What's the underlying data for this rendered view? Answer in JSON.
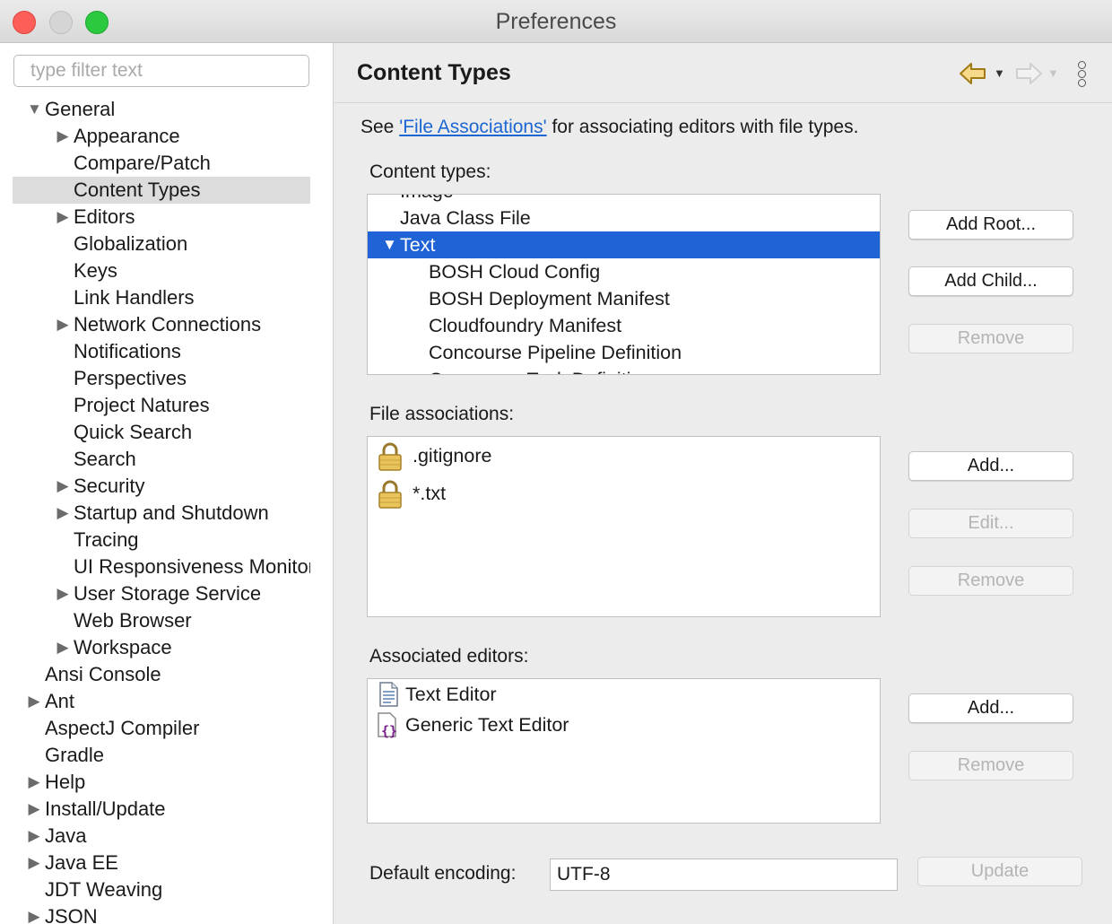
{
  "window": {
    "title": "Preferences"
  },
  "sidebar": {
    "filter_placeholder": "type filter text",
    "items": [
      {
        "label": "General",
        "expander": "expanded",
        "level": 0
      },
      {
        "label": "Appearance",
        "expander": "collapsed",
        "level": 1
      },
      {
        "label": "Compare/Patch",
        "expander": "none",
        "level": 1
      },
      {
        "label": "Content Types",
        "expander": "none",
        "level": 1,
        "selected": true
      },
      {
        "label": "Editors",
        "expander": "collapsed",
        "level": 1
      },
      {
        "label": "Globalization",
        "expander": "none",
        "level": 1
      },
      {
        "label": "Keys",
        "expander": "none",
        "level": 1
      },
      {
        "label": "Link Handlers",
        "expander": "none",
        "level": 1
      },
      {
        "label": "Network Connections",
        "expander": "collapsed",
        "level": 1
      },
      {
        "label": "Notifications",
        "expander": "none",
        "level": 1
      },
      {
        "label": "Perspectives",
        "expander": "none",
        "level": 1
      },
      {
        "label": "Project Natures",
        "expander": "none",
        "level": 1
      },
      {
        "label": "Quick Search",
        "expander": "none",
        "level": 1
      },
      {
        "label": "Search",
        "expander": "none",
        "level": 1
      },
      {
        "label": "Security",
        "expander": "collapsed",
        "level": 1
      },
      {
        "label": "Startup and Shutdown",
        "expander": "collapsed",
        "level": 1
      },
      {
        "label": "Tracing",
        "expander": "none",
        "level": 1
      },
      {
        "label": "UI Responsiveness Monitoring",
        "expander": "none",
        "level": 1
      },
      {
        "label": "User Storage Service",
        "expander": "collapsed",
        "level": 1
      },
      {
        "label": "Web Browser",
        "expander": "none",
        "level": 1
      },
      {
        "label": "Workspace",
        "expander": "collapsed",
        "level": 1
      },
      {
        "label": "Ansi Console",
        "expander": "none",
        "level": 0
      },
      {
        "label": "Ant",
        "expander": "collapsed",
        "level": 0
      },
      {
        "label": "AspectJ Compiler",
        "expander": "none",
        "level": 0
      },
      {
        "label": "Gradle",
        "expander": "none",
        "level": 0
      },
      {
        "label": "Help",
        "expander": "collapsed",
        "level": 0
      },
      {
        "label": "Install/Update",
        "expander": "collapsed",
        "level": 0
      },
      {
        "label": "Java",
        "expander": "collapsed",
        "level": 0
      },
      {
        "label": "Java EE",
        "expander": "collapsed",
        "level": 0
      },
      {
        "label": "JDT Weaving",
        "expander": "none",
        "level": 0
      },
      {
        "label": "JSON",
        "expander": "collapsed",
        "level": 0
      }
    ]
  },
  "main": {
    "title": "Content Types",
    "description_prefix": "See ",
    "description_link": "'File Associations'",
    "description_suffix": " for associating editors with file types.",
    "content_types": {
      "label": "Content types:",
      "items": [
        {
          "label": "Image",
          "expander": "none",
          "level": 1
        },
        {
          "label": "Java Class File",
          "expander": "none",
          "level": 1
        },
        {
          "label": "Text",
          "expander": "expanded",
          "level": 1,
          "selected": true
        },
        {
          "label": "BOSH Cloud Config",
          "expander": "none",
          "level": 2
        },
        {
          "label": "BOSH Deployment Manifest",
          "expander": "none",
          "level": 2
        },
        {
          "label": "Cloudfoundry Manifest",
          "expander": "none",
          "level": 2
        },
        {
          "label": "Concourse Pipeline Definition",
          "expander": "none",
          "level": 2
        },
        {
          "label": "Concourse Task Definition",
          "expander": "none",
          "level": 2
        }
      ],
      "buttons": {
        "add_root": "Add Root...",
        "add_child": "Add Child...",
        "remove": "Remove"
      }
    },
    "file_associations": {
      "label": "File associations:",
      "items": [
        {
          "label": ".gitignore",
          "icon": "lock-icon"
        },
        {
          "label": "*.txt",
          "icon": "lock-icon"
        }
      ],
      "buttons": {
        "add": "Add...",
        "edit": "Edit...",
        "remove": "Remove"
      }
    },
    "associated_editors": {
      "label": "Associated editors:",
      "items": [
        {
          "label": "Text Editor",
          "icon": "text-file-icon"
        },
        {
          "label": "Generic Text Editor",
          "icon": "generic-editor-icon"
        }
      ],
      "buttons": {
        "add": "Add...",
        "remove": "Remove"
      }
    },
    "default_encoding": {
      "label": "Default encoding:",
      "value": "UTF-8",
      "update_label": "Update"
    }
  },
  "colors": {
    "selection": "#1f63d6",
    "link": "#1b66d2",
    "close": "#fd5f58",
    "maximize": "#2bc840",
    "lock": "#c8a13c"
  }
}
